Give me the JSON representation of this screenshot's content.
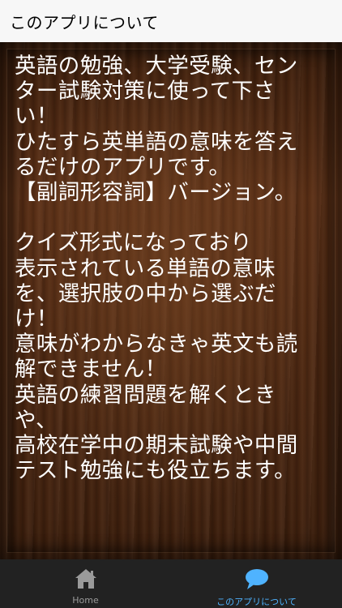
{
  "app_bar": {
    "title": "このアプリについて"
  },
  "about": {
    "text": "英語の勉強、大学受験、セン\nター試験対策に使って下さ\nい！\nひたすら英単語の意味を答え\nるだけのアプリです。\n【副詞形容詞】バージョン。\n\nクイズ形式になっており\n表示されている単語の意味\nを、選択肢の中から選ぶだ\nけ！\n意味がわからなきゃ英文も読\n解できません！\n英語の練習問題を解くとき\nや、\n高校在学中の期末試験や中間\nテスト勉強にも役立ちます。"
  },
  "bottom_nav": {
    "items": [
      {
        "label": "Home",
        "icon": "home-icon",
        "active": false
      },
      {
        "label": "このアプリについて",
        "icon": "speech-bubble-icon",
        "active": true
      }
    ]
  },
  "colors": {
    "accent": "#4fb3ff",
    "nav_background": "#222222",
    "app_bar_background": "#f7f7f7",
    "text_on_wood": "#ffffff"
  }
}
